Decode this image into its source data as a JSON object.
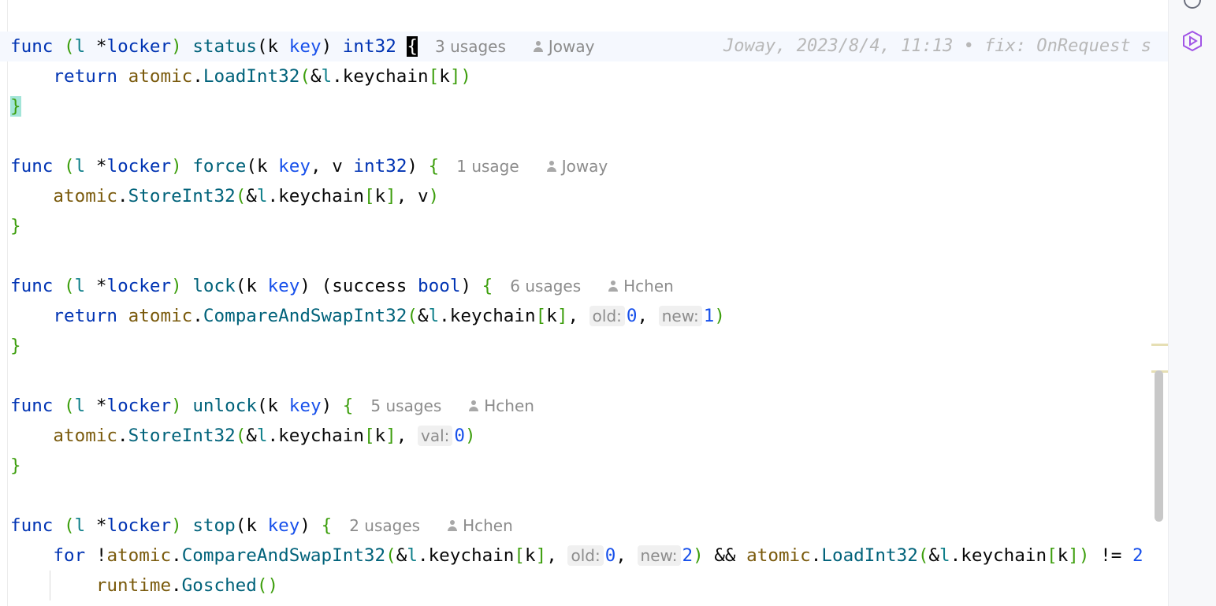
{
  "blame": "Joway, 2023/8/4, 11:13 • fix: OnRequest s",
  "functions": [
    {
      "receiver_var": "l",
      "receiver_type": "locker",
      "name": "status",
      "param": "k",
      "param_type": "key",
      "return_type": "int32",
      "usages": "3 usages",
      "author": "Joway",
      "body_keyword": "return",
      "body_pkg": "atomic",
      "body_call": "LoadInt32",
      "body_recv": "l",
      "body_field": "keychain",
      "body_index": "k"
    },
    {
      "receiver_var": "l",
      "receiver_type": "locker",
      "name": "force",
      "param": "k",
      "param_type": "key",
      "param2": "v",
      "param2_type": "int32",
      "usages": "1 usage",
      "author": "Joway",
      "body_pkg": "atomic",
      "body_call": "StoreInt32",
      "body_recv": "l",
      "body_field": "keychain",
      "body_index": "k",
      "body_arg": "v"
    },
    {
      "receiver_var": "l",
      "receiver_type": "locker",
      "name": "lock",
      "param": "k",
      "param_type": "key",
      "result_name": "success",
      "result_type": "bool",
      "usages": "6 usages",
      "author": "Hchen",
      "body_keyword": "return",
      "body_pkg": "atomic",
      "body_call": "CompareAndSwapInt32",
      "body_recv": "l",
      "body_field": "keychain",
      "body_index": "k",
      "hint1": "old:",
      "val1": "0",
      "hint2": "new:",
      "val2": "1"
    },
    {
      "receiver_var": "l",
      "receiver_type": "locker",
      "name": "unlock",
      "param": "k",
      "param_type": "key",
      "usages": "5 usages",
      "author": "Hchen",
      "body_pkg": "atomic",
      "body_call": "StoreInt32",
      "body_recv": "l",
      "body_field": "keychain",
      "body_index": "k",
      "hint1": "val:",
      "val1": "0"
    },
    {
      "receiver_var": "l",
      "receiver_type": "locker",
      "name": "stop",
      "param": "k",
      "param_type": "key",
      "usages": "2 usages",
      "author": "Hchen",
      "body_keyword": "for",
      "body_pkg": "atomic",
      "body_call": "CompareAndSwapInt32",
      "body_recv": "l",
      "body_field": "keychain",
      "body_index": "k",
      "hint1": "old:",
      "val1": "0",
      "hint2": "new:",
      "val2": "2",
      "body_pkg2": "atomic",
      "body_call2": "LoadInt32",
      "body_cmp_val": "2",
      "inner_pkg": "runtime",
      "inner_call": "Gosched"
    }
  ],
  "keywords": {
    "func": "func"
  },
  "colors": {
    "keyword": "#0033b3",
    "function": "#00627a",
    "package": "#7a5a0c",
    "number": "#1750eb",
    "bracket": "#3c9e0c",
    "current_line": "#f5f8fe"
  },
  "icons": [
    "notifications-icon",
    "ai-assistant-icon"
  ]
}
